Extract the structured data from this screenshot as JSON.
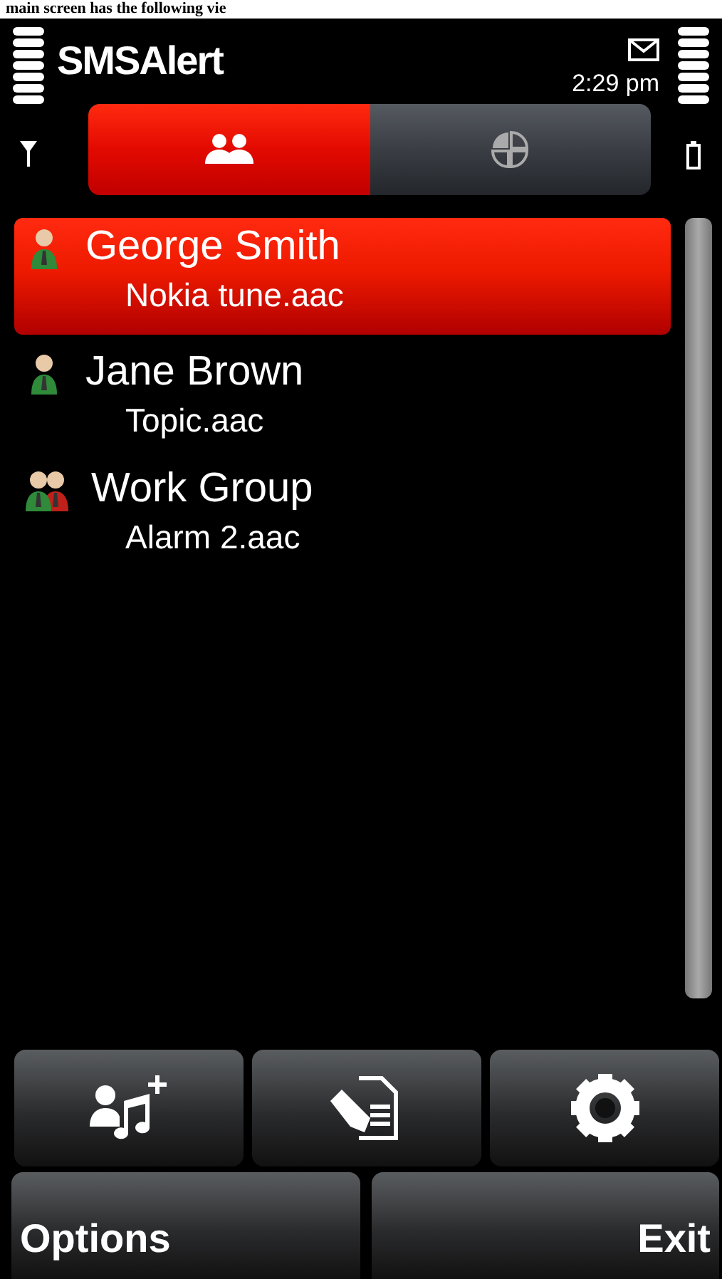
{
  "caption": "main screen has the following vie",
  "app": {
    "title": "SMSAlert",
    "time": "2:29 pm"
  },
  "tabs": [
    {
      "kind": "contacts",
      "selected": true
    },
    {
      "kind": "pie",
      "selected": false
    }
  ],
  "contacts": [
    {
      "kind": "person",
      "name": "George Smith",
      "tone": "Nokia tune.aac",
      "selected": true
    },
    {
      "kind": "person",
      "name": "Jane Brown",
      "tone": "Topic.aac",
      "selected": false
    },
    {
      "kind": "group",
      "name": "Work Group",
      "tone": "Alarm 2.aac",
      "selected": false
    }
  ],
  "toolbar": [
    {
      "kind": "add-tone"
    },
    {
      "kind": "edit"
    },
    {
      "kind": "settings"
    }
  ],
  "softkeys": {
    "left": "Options",
    "right": "Exit"
  }
}
